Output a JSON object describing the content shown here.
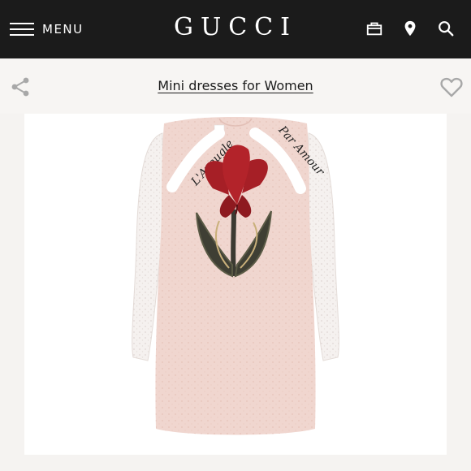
{
  "header": {
    "menu_label": "MENU",
    "logo_text": "GUCCI",
    "icons": [
      "shopping-bag-icon",
      "location-pin-icon",
      "search-icon"
    ]
  },
  "subheader": {
    "category_link": "Mini dresses for Women",
    "left_icon": "share-icon",
    "right_icon": "heart-icon"
  },
  "product_image": {
    "description_text_left": "L'Aveugle",
    "description_text_right": "Par Amour"
  },
  "colors": {
    "topbar": "#1b1b1b",
    "dress": "#f0d6cf",
    "flower": "#b3232a"
  }
}
